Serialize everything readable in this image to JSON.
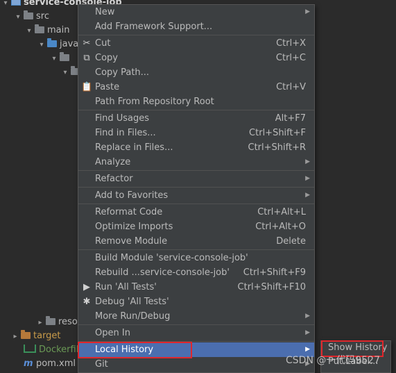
{
  "tree": {
    "root": "service-console-job",
    "src": "src",
    "main": "main",
    "java": "java",
    "resources_partial": "reso",
    "target": "target",
    "dockerfile": "Dockerfile",
    "pom": "pom.xml"
  },
  "menu": {
    "items": {
      "new": "New",
      "add_framework": "Add Framework Support...",
      "cut": "Cut",
      "cut_sc": "Ctrl+X",
      "copy": "Copy",
      "copy_sc": "Ctrl+C",
      "copy_path": "Copy Path...",
      "paste": "Paste",
      "paste_sc": "Ctrl+V",
      "path_from_root": "Path From Repository Root",
      "find_usages": "Find Usages",
      "find_usages_sc": "Alt+F7",
      "find_in_files": "Find in Files...",
      "find_in_files_sc": "Ctrl+Shift+F",
      "replace_in_files": "Replace in Files...",
      "replace_in_files_sc": "Ctrl+Shift+R",
      "analyze": "Analyze",
      "refactor": "Refactor",
      "add_to_favorites": "Add to Favorites",
      "reformat_code": "Reformat Code",
      "reformat_code_sc": "Ctrl+Alt+L",
      "optimize_imports": "Optimize Imports",
      "optimize_imports_sc": "Ctrl+Alt+O",
      "remove_module": "Remove Module",
      "remove_module_sc": "Delete",
      "build_module": "Build Module 'service-console-job'",
      "rebuild": "Rebuild ...service-console-job'",
      "rebuild_sc": "Ctrl+Shift+F9",
      "run_tests": "Run 'All Tests'",
      "run_tests_sc": "Ctrl+Shift+F10",
      "debug_tests": "Debug 'All Tests'",
      "more_run_debug": "More Run/Debug",
      "open_in": "Open In",
      "local_history": "Local History",
      "git": "Git"
    }
  },
  "submenu": {
    "show_history": "Show History",
    "put_label": "Put Label..."
  },
  "watermark": "CSDN @一代码9527",
  "colors": {
    "background": "#2b2b2b",
    "menu_bg": "#3c3f41",
    "selection": "#4b6eaf",
    "highlight_box": "#e0262b",
    "run_icon": "#499c54"
  }
}
